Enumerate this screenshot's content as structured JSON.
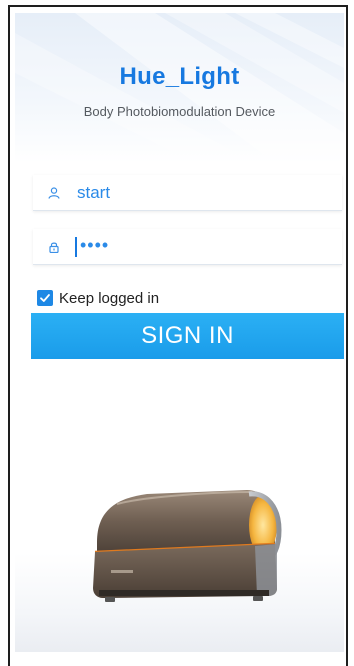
{
  "app": {
    "title": "Hue_Light",
    "subtitle": "Body Photobiomodulation Device"
  },
  "login": {
    "username_value": "start",
    "password_value": "••••",
    "keep_logged_in_label": "Keep logged in",
    "keep_logged_in_checked": true,
    "sign_in_label": "SIGN IN"
  },
  "icons": {
    "username": "user-icon",
    "password": "lock-icon",
    "checkbox": "check-icon"
  },
  "colors": {
    "title": "#1779e0",
    "button": "#1a9cea",
    "checkbox": "#1e88e5",
    "text_value": "#2a8ae8"
  },
  "image": {
    "subject": "tanning-bed-device"
  }
}
